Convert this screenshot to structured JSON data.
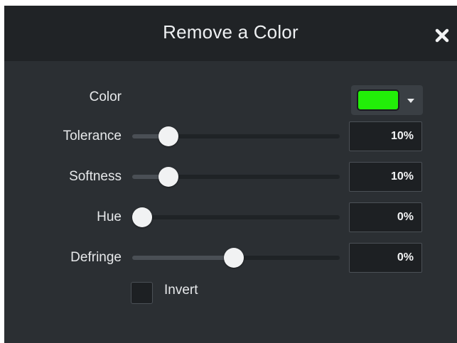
{
  "dialog": {
    "title": "Remove a Color",
    "close_icon": "close-icon"
  },
  "color": {
    "label": "Color",
    "value": "#22ee08",
    "dropdown_icon": "chevron-down-icon"
  },
  "sliders": [
    {
      "key": "tolerance",
      "label": "Tolerance",
      "value_text": "10%",
      "level": 0.14
    },
    {
      "key": "softness",
      "label": "Softness",
      "value_text": "10%",
      "level": 0.14
    },
    {
      "key": "hue",
      "label": "Hue",
      "value_text": "0%",
      "level": 0.0
    },
    {
      "key": "defringe",
      "label": "Defringe",
      "value_text": "0%",
      "level": 0.49
    }
  ],
  "invert": {
    "label": "Invert",
    "checked": false
  },
  "colors": {
    "panel_bg": "#2b2f33",
    "header_bg": "#202326",
    "swatch": "#22ee08"
  }
}
